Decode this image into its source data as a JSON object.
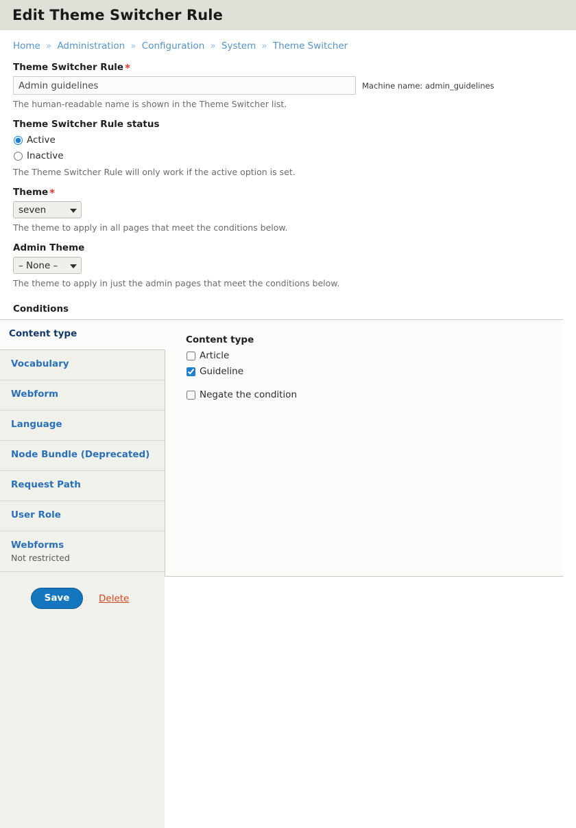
{
  "header": {
    "title": "Edit Theme Switcher Rule"
  },
  "breadcrumb": {
    "separator": "»",
    "items": [
      {
        "label": "Home"
      },
      {
        "label": "Administration"
      },
      {
        "label": "Configuration"
      },
      {
        "label": "System"
      },
      {
        "label": "Theme Switcher"
      }
    ]
  },
  "form": {
    "rule_name": {
      "label": "Theme Switcher Rule",
      "required_marker": "*",
      "value": "Admin guidelines",
      "placeholder": "",
      "machine_name": "Machine name: admin_guidelines",
      "description": "The human-readable name is shown in the Theme Switcher list."
    },
    "status": {
      "label": "Theme Switcher Rule status",
      "options": [
        {
          "label": "Active",
          "selected": true
        },
        {
          "label": "Inactive",
          "selected": false
        }
      ],
      "description": "The Theme Switcher Rule will only work if the active option is set."
    },
    "theme": {
      "label": "Theme",
      "required_marker": "*",
      "value": "seven",
      "description": "The theme to apply in all pages that meet the conditions below."
    },
    "admin_theme": {
      "label": "Admin Theme",
      "value": "– None –",
      "description": "The theme to apply in just the admin pages that meet the conditions below."
    },
    "conditions": {
      "label": "Conditions",
      "tabs": [
        {
          "title": "Content type",
          "summary": "",
          "selected": true
        },
        {
          "title": "Vocabulary",
          "summary": "",
          "selected": false
        },
        {
          "title": "Webform",
          "summary": "",
          "selected": false
        },
        {
          "title": "Language",
          "summary": "",
          "selected": false
        },
        {
          "title": "Node Bundle (Deprecated)",
          "summary": "",
          "selected": false
        },
        {
          "title": "Request Path",
          "summary": "",
          "selected": false
        },
        {
          "title": "User Role",
          "summary": "",
          "selected": false
        },
        {
          "title": "Webforms",
          "summary": "Not restricted",
          "selected": false
        }
      ],
      "pane": {
        "title": "Content type",
        "checkboxes": [
          {
            "label": "Article",
            "checked": false
          },
          {
            "label": "Guideline",
            "checked": true
          }
        ],
        "negate": {
          "label": "Negate the condition",
          "checked": false
        }
      }
    }
  },
  "actions": {
    "save_label": "Save",
    "delete_label": "Delete"
  },
  "colors": {
    "header_bg": "#e0e0d8",
    "link_blue": "#5593c9",
    "tab_link_blue": "#2a70b8",
    "accent_blue": "#1476bf",
    "required_red": "#e5372c",
    "delete_orange": "#d2461b"
  }
}
